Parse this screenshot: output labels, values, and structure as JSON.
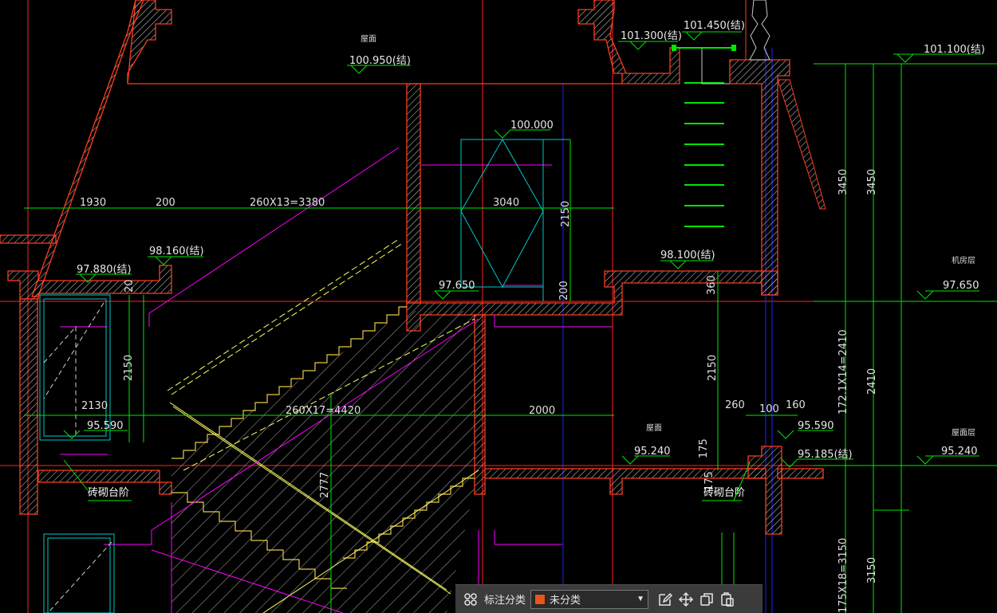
{
  "colors": {
    "background": "#000000",
    "wall_outline": "#ff3b1f",
    "wall_hatch": "#d8d8d8",
    "hatch_fill": "#e6c94a",
    "dimension": "#00e600",
    "magenta": "#ff00ff",
    "cyan": "#00c8c8",
    "blue": "#2020ff",
    "red_axis": "#ff2020",
    "yellow": "#ffff60",
    "swatch": "#e8541d"
  },
  "elevations": {
    "e101450": "101.450(结)",
    "e101300": "101.300(结)",
    "e101100": "101.100(结)",
    "e100950": "100.950(结)",
    "e100000": "100.000",
    "e98160": "98.160(结)",
    "e97880": "97.880(结)",
    "e98100": "98.100(结)",
    "e97650a": "97.650",
    "e97650b": "97.650",
    "e95590a": "95.590",
    "e95590b": "95.590",
    "e95240a": "95.240",
    "e95240b": "95.240",
    "e95185": "95.185(结)"
  },
  "dimensions": {
    "d1930": "1930",
    "d200a": "200",
    "d_stairs13": "260X13=3380",
    "d3040": "3040",
    "d2150a": "2150",
    "d200b": "200",
    "d360": "360",
    "d2150b": "2150",
    "d2150c": "2150",
    "d2130": "2130",
    "d_stairs17": "260X17=4420",
    "d2000": "2000",
    "d260": "260",
    "d100": "100",
    "d160": "160",
    "d175a": "175",
    "d175b": "175",
    "d2777": "2777",
    "d20": "20",
    "d3450a": "3450",
    "d3450b": "3450",
    "d_stairs14": "172.1X14=2410",
    "d2410": "2410",
    "d_stairs18": "175X18=3150",
    "d3150": "3150"
  },
  "annotations": {
    "roof_a": "屋面",
    "roof_b": "屋面",
    "roof_c": "屋面层",
    "machine_room": "机房层",
    "brick_step_a": "砖砌台阶",
    "brick_step_b": "砖砌台阶"
  },
  "toolbar": {
    "label": "标注分类",
    "selected": "未分类",
    "icons": [
      "grid-icon",
      "edit-icon",
      "move-icon",
      "copy-icon",
      "paste-icon"
    ]
  }
}
